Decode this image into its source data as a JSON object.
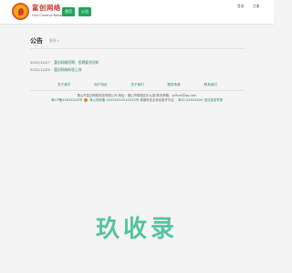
{
  "header": {
    "logo_cn": "富创网络",
    "logo_en": "First Creative Network",
    "nav": [
      "首页",
      "公告"
    ],
    "top_links": [
      "登录",
      "注册"
    ]
  },
  "main": {
    "title": "公告",
    "more": "更多 »",
    "notices": [
      {
        "date": "2022/12/27",
        "title": "富创网络招聘、招聘要求须知"
      },
      {
        "date": "2022/12/26",
        "title": "富创网络新版上线"
      }
    ]
  },
  "footer": {
    "links": [
      "关于我们",
      "用户协议",
      "关于我们",
      "服务条款",
      "联系我们"
    ],
    "copyright": "佛山市富创网络科技有限公司  地址：佛山市顺德区乐从镇 联系邮箱：gdfcwl@qq.com",
    "icp": "粤ICP备XXXXXXXX号",
    "police": "粤公网安备 XXXXXXXXXXXXXX号",
    "license": "增值电信业务经营许可证：",
    "license_no": "粤B2-XXXXXXXX",
    "report": "违法信息举报"
  },
  "watermark": "玖收录",
  "colors": {
    "accent": "#23a55a",
    "link": "#2e8b57",
    "watermark": "#56c2a0"
  }
}
